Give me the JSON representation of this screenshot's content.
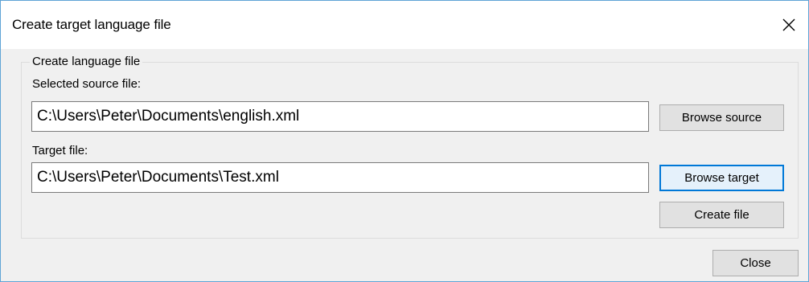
{
  "window": {
    "title": "Create target language file",
    "close_icon": "close-icon"
  },
  "group": {
    "legend": "Create language file",
    "source_label": "Selected source file:",
    "source_value": "C:\\Users\\Peter\\Documents\\english.xml",
    "browse_source_label": "Browse source",
    "target_label": "Target file:",
    "target_value": "C:\\Users\\Peter\\Documents\\Test.xml",
    "browse_target_label": "Browse target",
    "create_file_label": "Create file"
  },
  "footer": {
    "close_label": "Close"
  },
  "colors": {
    "window_border": "#5fa4d6",
    "focus_accent": "#0078d7",
    "dialog_background": "#f0f0f0"
  }
}
